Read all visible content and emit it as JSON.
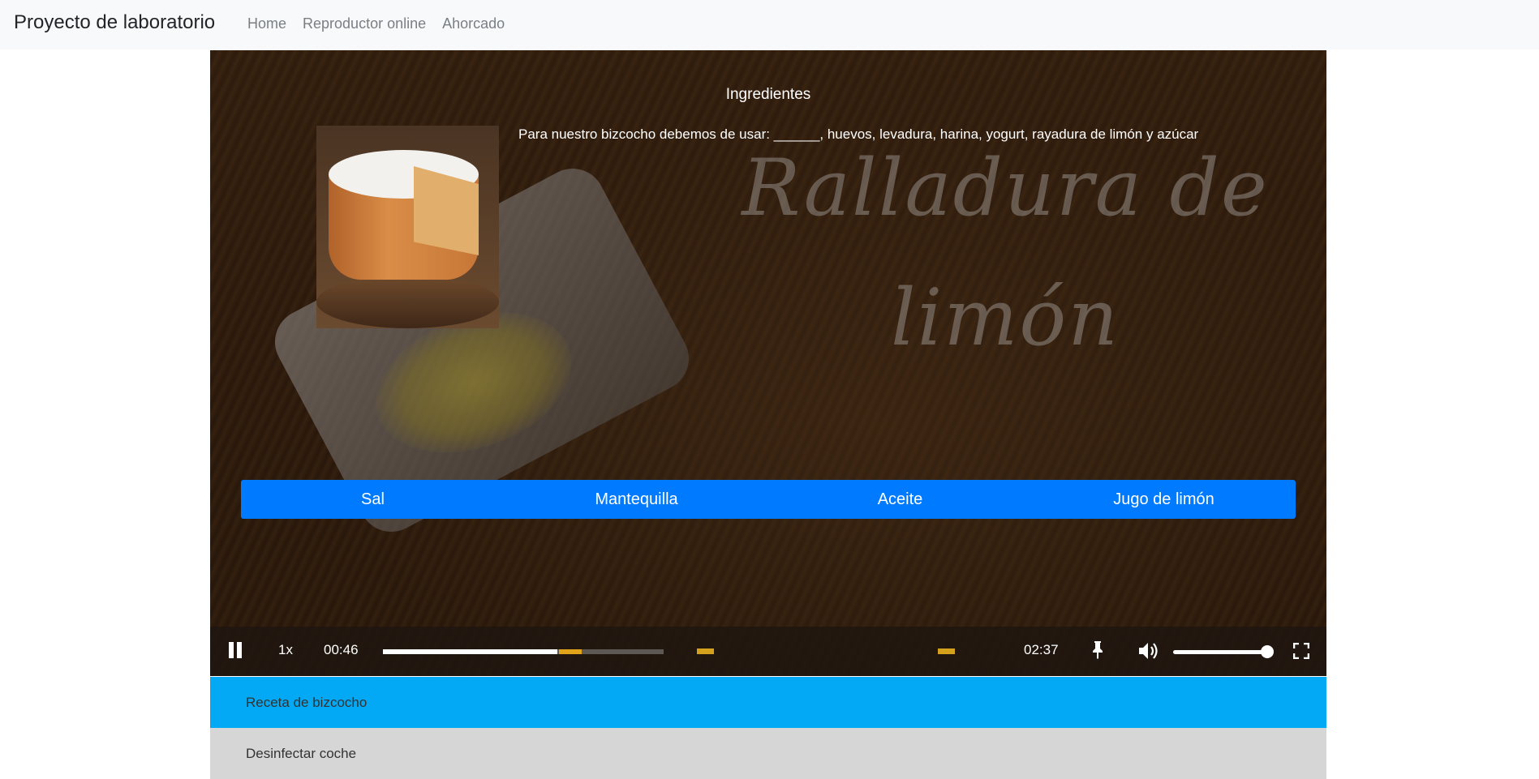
{
  "navbar": {
    "brand": "Proyecto de laboratorio",
    "links": [
      "Home",
      "Reproductor online",
      "Ahorcado"
    ]
  },
  "video": {
    "caption_line1": "Ralladura de",
    "caption_line2": "limón"
  },
  "question": {
    "title": "Ingredientes",
    "text": "Para nuestro bizcocho debemos de usar: ______, huevos, levadura, harina, yogurt, rayadura de limón y azúcar",
    "options": [
      "Sal",
      "Mantequilla",
      "Aceite",
      "Jugo de limón"
    ]
  },
  "controls": {
    "speed": "1x",
    "current_time": "00:46",
    "total_time": "02:37",
    "progress_played_fraction": 0.62,
    "volume_fraction": 1.0
  },
  "playlist": {
    "items": [
      "Receta de bizcocho",
      "Desinfectar coche"
    ]
  },
  "colors": {
    "accent_blue": "#007bff",
    "playlist_active": "#03a9f4",
    "playlist_inactive": "#d6d6d6",
    "marker": "#d4a11c"
  }
}
